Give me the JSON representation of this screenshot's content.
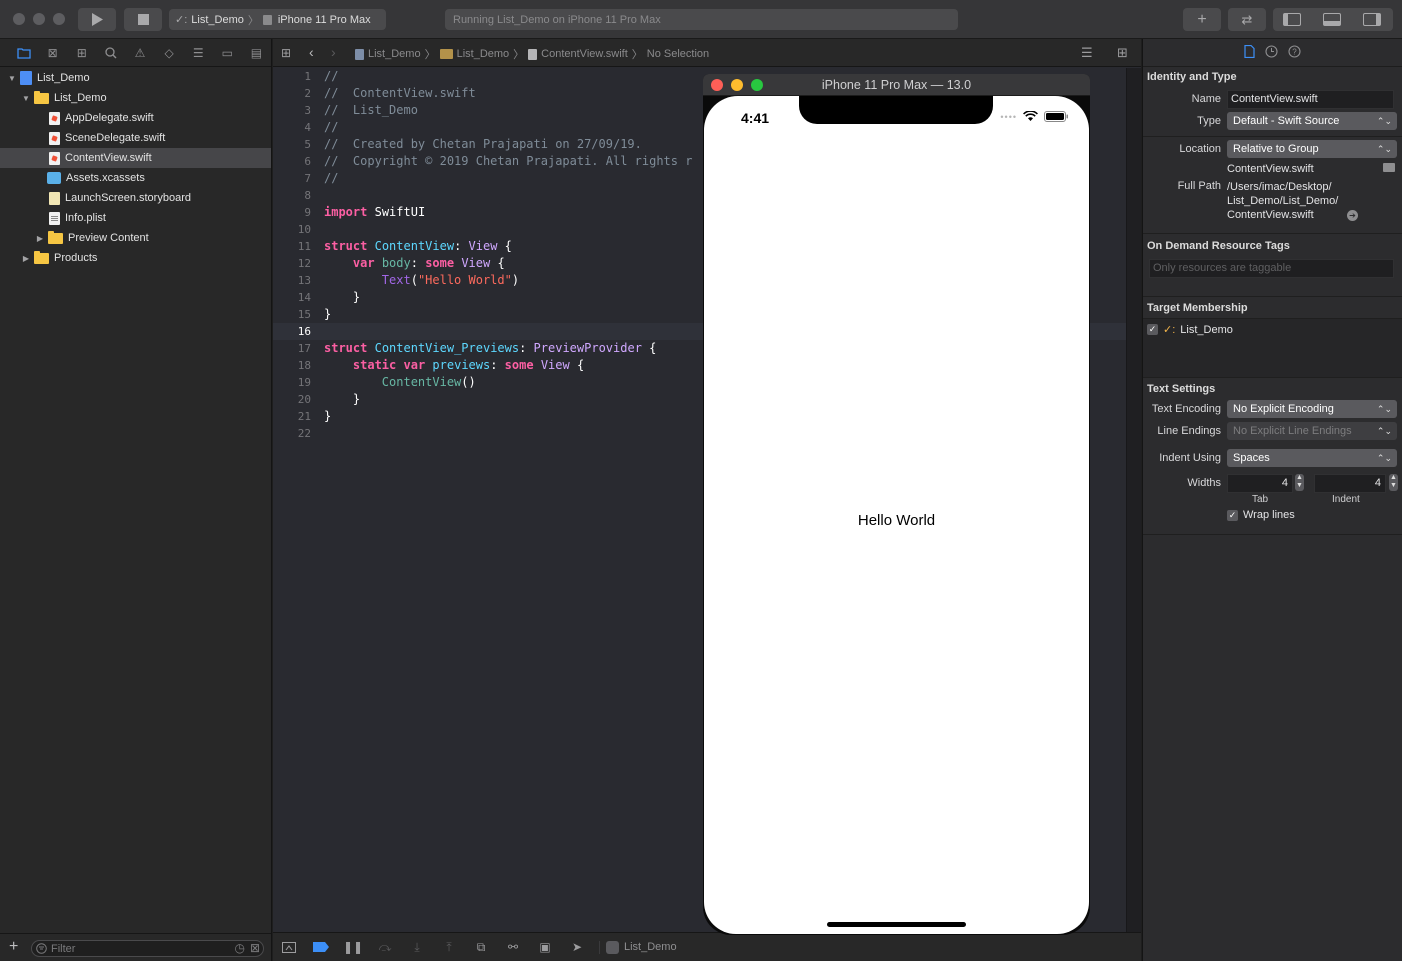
{
  "toolbar": {
    "scheme_target": "List_Demo",
    "device": "iPhone 11 Pro Max",
    "activity_text": "Running List_Demo on iPhone 11 Pro Max"
  },
  "navigator": {
    "items": [
      {
        "label": "List_Demo",
        "kind": "project"
      },
      {
        "label": "List_Demo",
        "kind": "folder"
      },
      {
        "label": "AppDelegate.swift",
        "kind": "swift"
      },
      {
        "label": "SceneDelegate.swift",
        "kind": "swift"
      },
      {
        "label": "ContentView.swift",
        "kind": "swift"
      },
      {
        "label": "Assets.xcassets",
        "kind": "assets"
      },
      {
        "label": "LaunchScreen.storyboard",
        "kind": "storyboard"
      },
      {
        "label": "Info.plist",
        "kind": "plist"
      },
      {
        "label": "Preview Content",
        "kind": "folder"
      },
      {
        "label": "Products",
        "kind": "folder"
      }
    ],
    "filter_placeholder": "Filter"
  },
  "jumpbar": {
    "crumbs": [
      "List_Demo",
      "List_Demo",
      "ContentView.swift",
      "No Selection"
    ]
  },
  "code": {
    "line_numbers": [
      "1",
      "2",
      "3",
      "4",
      "5",
      "6",
      "7",
      "8",
      "9",
      "10",
      "11",
      "12",
      "13",
      "14",
      "15",
      "16",
      "17",
      "18",
      "19",
      "20",
      "21",
      "22"
    ],
    "current_line": "16"
  },
  "debug_bar": {
    "target": "List_Demo"
  },
  "simulator": {
    "title": "iPhone 11 Pro Max — 13.0",
    "time": "4:41",
    "content_text": "Hello World"
  },
  "inspector": {
    "identity_title": "Identity and Type",
    "name_label": "Name",
    "name_value": "ContentView.swift",
    "type_label": "Type",
    "type_value": "Default - Swift Source",
    "location_label": "Location",
    "location_value": "Relative to Group",
    "location_file": "ContentView.swift",
    "full_path_label": "Full Path",
    "full_path_line1": "/Users/imac/Desktop/",
    "full_path_line2": "List_Demo/List_Demo/",
    "full_path_line3": "ContentView.swift",
    "odr_title": "On Demand Resource Tags",
    "odr_placeholder": "Only resources are taggable",
    "target_title": "Target Membership",
    "target_name": "List_Demo",
    "text_settings_title": "Text Settings",
    "encoding_label": "Text Encoding",
    "encoding_value": "No Explicit Encoding",
    "line_endings_label": "Line Endings",
    "line_endings_value": "No Explicit Line Endings",
    "indent_using_label": "Indent Using",
    "indent_using_value": "Spaces",
    "widths_label": "Widths",
    "tab_value": "4",
    "indent_value": "4",
    "tab_caption": "Tab",
    "indent_caption": "Indent",
    "wrap_lines_label": "Wrap lines"
  },
  "colors": {
    "accent": "#3c8ff7",
    "keyword": "#fc5fa3",
    "string": "#fc6a5d",
    "comment": "#7f8c98",
    "type": "#5dd8ff"
  }
}
